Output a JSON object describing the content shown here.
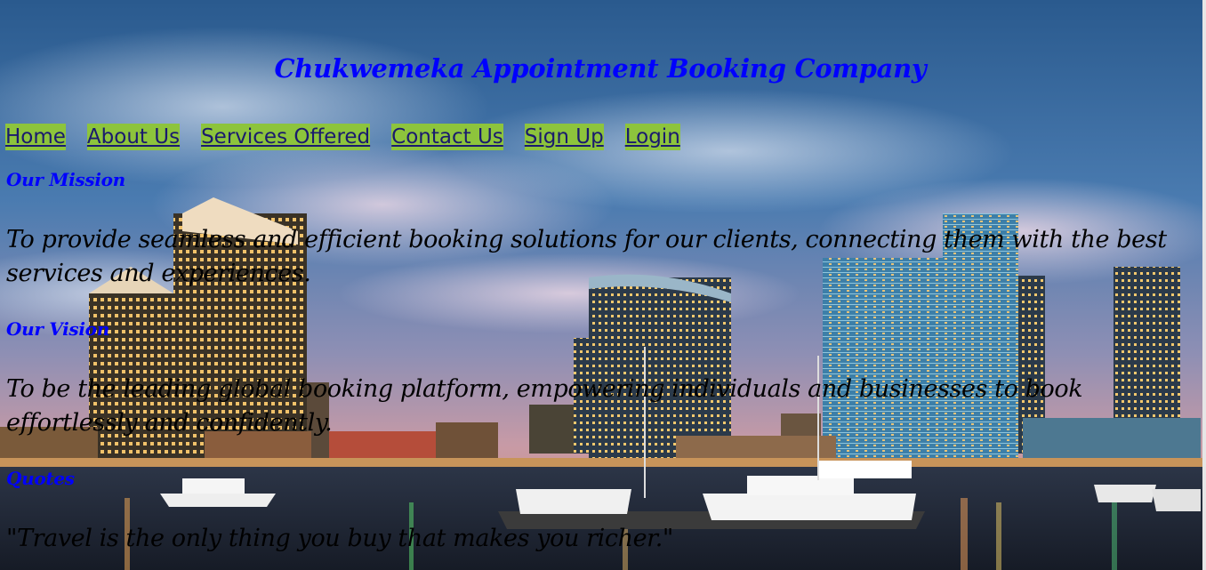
{
  "header": {
    "title": "Chukwemeka Appointment Booking Company"
  },
  "nav": {
    "items": [
      {
        "label": "Home"
      },
      {
        "label": "About Us"
      },
      {
        "label": "Services Offered"
      },
      {
        "label": "Contact Us"
      },
      {
        "label": "Sign Up"
      },
      {
        "label": "Login"
      }
    ]
  },
  "sections": {
    "mission": {
      "heading": "Our Mission",
      "text": "To provide seamless and efficient booking solutions for our clients, connecting them with the best services and experiences."
    },
    "vision": {
      "heading": "Our Vision",
      "text": "To be the leading global booking platform, empowering individuals and businesses to book effortlessly and confidently."
    },
    "quotes": {
      "heading": "Quotes",
      "text": "\"Travel is the only thing you buy that makes you richer.\""
    }
  },
  "colors": {
    "title": "#0000ff",
    "nav_background": "#8dc43c",
    "nav_text": "#1a1a6e",
    "heading": "#0000ff",
    "body_text": "#000000"
  },
  "background": {
    "icon": "city-skyline-marina-night-image"
  }
}
